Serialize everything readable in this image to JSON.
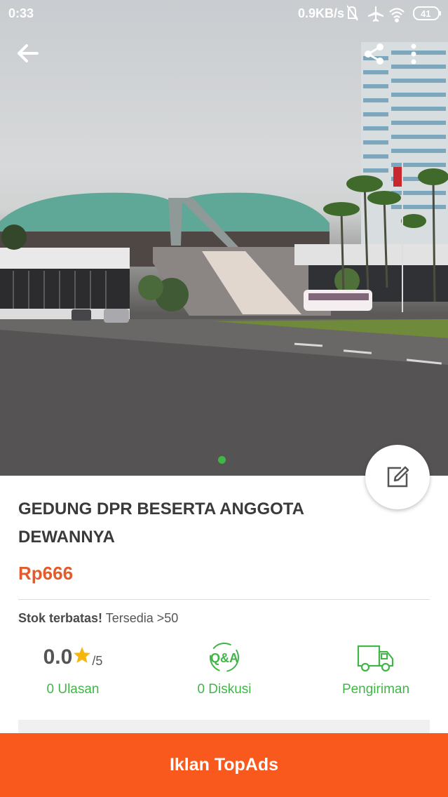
{
  "status_bar": {
    "time": "0:33",
    "network_speed": "0.9KB/s",
    "battery": "41",
    "icons": [
      "mute-icon",
      "airplane-icon",
      "wifi-icon",
      "battery-icon"
    ]
  },
  "header": {
    "back_icon": "arrow-left-icon",
    "share_icon": "share-icon",
    "more_icon": "more-vertical-icon"
  },
  "gallery": {
    "image_subject": "parliament-building-photo",
    "page_index": 1,
    "page_count": 1
  },
  "product": {
    "title": "GEDUNG DPR BESERTA ANGGOTA DEWANNYA",
    "price": "Rp666",
    "stock_label": "Stok terbatas!",
    "stock_value": "Tersedia >50"
  },
  "stats": {
    "rating_value": "0.0",
    "rating_max": "/5",
    "reviews_label": "0 Ulasan",
    "qa_icon_text": "Q&A",
    "discussion_label": "0 Diskusi",
    "shipping_label": "Pengiriman"
  },
  "cta": {
    "label": "Iklan TopAds",
    "color": "#fa591d"
  },
  "colors": {
    "accent_green": "#42b549",
    "price_orange": "#e35b2a"
  }
}
